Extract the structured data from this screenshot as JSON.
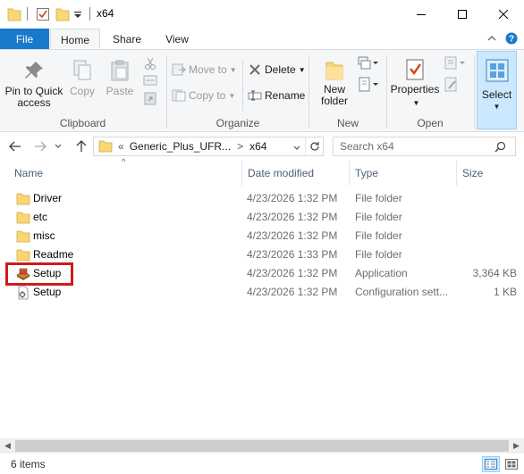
{
  "window": {
    "title": "x64",
    "controls": {
      "minimize": "minimize-icon",
      "maximize": "maximize-icon",
      "close": "close-icon"
    }
  },
  "ribbon_tabs": {
    "file": "File",
    "home": "Home",
    "share": "Share",
    "view": "View"
  },
  "ribbon": {
    "clipboard": {
      "pin_line1": "Pin to Quick",
      "pin_line2": "access",
      "copy": "Copy",
      "paste": "Paste",
      "group": "Clipboard"
    },
    "organize": {
      "move_to": "Move to",
      "copy_to": "Copy to",
      "delete": "Delete",
      "rename": "Rename",
      "group": "Organize"
    },
    "new": {
      "new_line1": "New",
      "new_line2": "folder",
      "group": "New"
    },
    "open": {
      "properties": "Properties",
      "group": "Open"
    },
    "select": {
      "select": "Select"
    }
  },
  "address": {
    "prefix": "«",
    "segment1": "Generic_Plus_UFR...",
    "separator": ">",
    "segment2": "x64",
    "search_placeholder": "Search x64"
  },
  "columns": {
    "name": "Name",
    "date": "Date modified",
    "type": "Type",
    "size": "Size"
  },
  "files": [
    {
      "name": "Driver",
      "date": "4/23/2026 1:32 PM",
      "type": "File folder",
      "size": "",
      "icon": "folder-icon"
    },
    {
      "name": "etc",
      "date": "4/23/2026 1:32 PM",
      "type": "File folder",
      "size": "",
      "icon": "folder-icon"
    },
    {
      "name": "misc",
      "date": "4/23/2026 1:32 PM",
      "type": "File folder",
      "size": "",
      "icon": "folder-icon"
    },
    {
      "name": "Readme",
      "date": "4/23/2026 1:33 PM",
      "type": "File folder",
      "size": "",
      "icon": "folder-icon"
    },
    {
      "name": "Setup",
      "date": "4/23/2026 1:32 PM",
      "type": "Application",
      "size": "3,364 KB",
      "icon": "setup-application-icon"
    },
    {
      "name": "Setup",
      "date": "4/23/2026 1:32 PM",
      "type": "Configuration sett...",
      "size": "1 KB",
      "icon": "config-file-icon"
    }
  ],
  "status": {
    "item_count": "6 items"
  },
  "colors": {
    "file_tab": "#1979ca",
    "folder": "#f8d775",
    "highlight": "#d11a1a",
    "column_header_text": "#4c607a"
  }
}
